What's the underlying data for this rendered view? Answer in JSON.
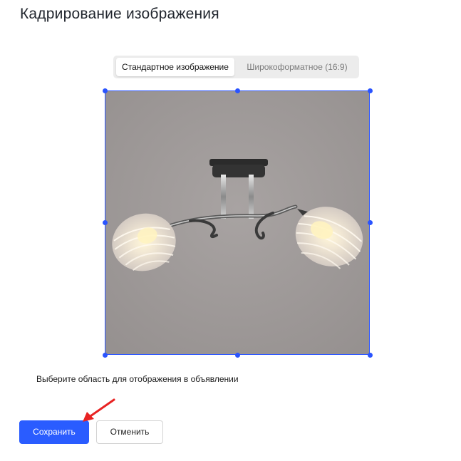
{
  "dialog": {
    "title": "Кадрирование изображения"
  },
  "aspect_toggle": {
    "options": [
      {
        "label": "Стандартное изображение",
        "selected": true
      },
      {
        "label": "Широкоформатное (16:9)",
        "selected": false
      }
    ]
  },
  "crop": {
    "handle_color": "#2a54ff",
    "image_background": "#9c9796"
  },
  "hint": {
    "text": "Выберите область для отображения в объявлении"
  },
  "actions": {
    "save_label": "Сохранить",
    "cancel_label": "Отменить",
    "primary_color": "#2a5cff"
  },
  "annotation": {
    "arrow_color": "#e82323"
  }
}
